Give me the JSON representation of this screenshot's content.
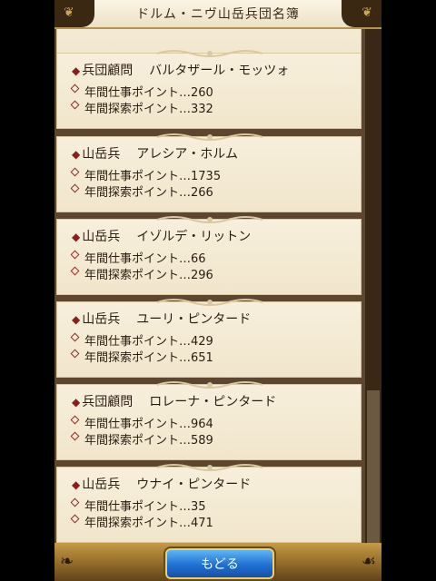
{
  "header": {
    "title": "ドルム・ニヴ山岳兵団名簿"
  },
  "members": [
    {
      "rank": "兵団顧問",
      "name": "バルタザール・モッツォ",
      "work_label": "年間仕事ポイント…",
      "work": "260",
      "explore_label": "年間探索ポイント…",
      "explore": "332"
    },
    {
      "rank": "山岳兵",
      "name": "アレシア・ホルム",
      "work_label": "年間仕事ポイント…",
      "work": "1735",
      "explore_label": "年間探索ポイント…",
      "explore": "266"
    },
    {
      "rank": "山岳兵",
      "name": "イゾルデ・リットン",
      "work_label": "年間仕事ポイント…",
      "work": "66",
      "explore_label": "年間探索ポイント…",
      "explore": "296"
    },
    {
      "rank": "山岳兵",
      "name": "ユーリ・ピンタード",
      "work_label": "年間仕事ポイント…",
      "work": "429",
      "explore_label": "年間探索ポイント…",
      "explore": "651"
    },
    {
      "rank": "兵団顧問",
      "name": "ロレーナ・ピンタード",
      "work_label": "年間仕事ポイント…",
      "work": "964",
      "explore_label": "年間探索ポイント…",
      "explore": "589"
    },
    {
      "rank": "山岳兵",
      "name": "ウナイ・ピンタード",
      "work_label": "年間仕事ポイント…",
      "work": "35",
      "explore_label": "年間探索ポイント…",
      "explore": "471"
    }
  ],
  "footer": {
    "back_label": "もどる"
  },
  "colors": {
    "accent": "#8b1d1d",
    "button": "#1f6fd3",
    "frame": "#5b4226"
  }
}
